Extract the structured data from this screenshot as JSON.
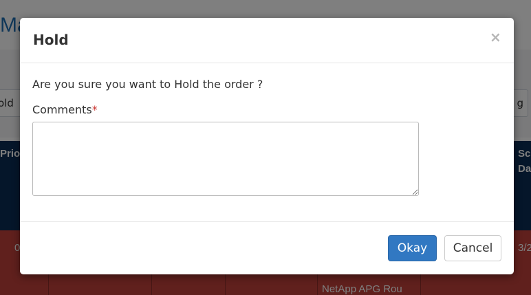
{
  "background": {
    "page_title_partial": "Ma",
    "filter_left_partial": "old",
    "filter_right_partial": "g",
    "table_headers": [
      {
        "text": "Prio"
      },
      {
        "text": "Sc\nDa"
      }
    ],
    "row_cells": [
      "0",
      "3/2",
      "NetApp APG Rou"
    ]
  },
  "modal": {
    "title": "Hold",
    "close_label": "×",
    "question": "Are you sure you want to Hold the order ?",
    "comments_label": "Comments",
    "required_mark": "*",
    "comments_value": "",
    "okay_label": "Okay",
    "cancel_label": "Cancel"
  },
  "colors": {
    "primary": "#3178c2",
    "table_header": "#0b2d55",
    "row_highlight": "#c0413b",
    "required": "#c9302c"
  }
}
